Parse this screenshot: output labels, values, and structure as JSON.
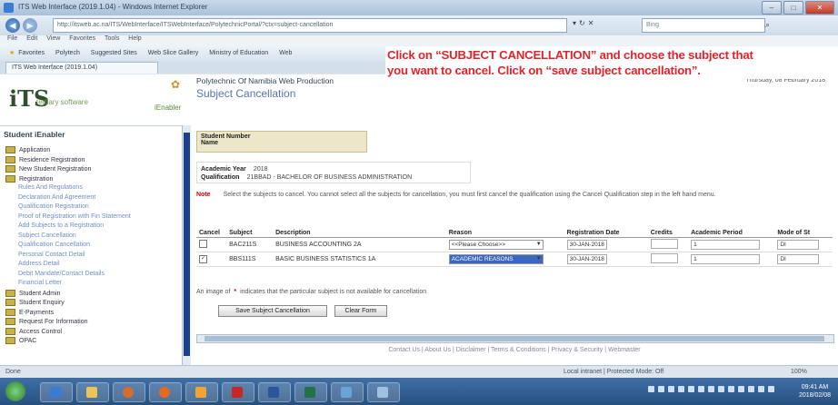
{
  "window": {
    "title": "ITS Web Interface (2019.1.04) - Windows Internet Explorer",
    "controls": [
      "–",
      "□",
      "✕"
    ]
  },
  "browser": {
    "address": "http://itsweb.ac.na/ITS/WebInterface/ITSWebInterface/PolytechnicPortal/?ctx=subject-cancellation",
    "addr_buttons": [
      "▾",
      "↻",
      "✕"
    ],
    "search_placeholder": "Bing",
    "menu": [
      "File",
      "Edit",
      "View",
      "Favorites",
      "Tools",
      "Help"
    ],
    "favorites": [
      "Favorites",
      "Polytech",
      "Suggested Sites",
      "Web Slice Gallery",
      "Ministry of Education",
      "Web"
    ],
    "tab": "ITS Web Interface (2019.1.04)"
  },
  "callout": {
    "line1": "Click on “SUBJECT CANCELLATION” and choose the subject that",
    "line2": "you want to cancel.  Click on “save subject cancellation”."
  },
  "header": {
    "logo_mark": "iTS",
    "logo_sub": "tertiary software",
    "portal": "iEnabler",
    "institution": "Polytechnic Of Namibia Web Production",
    "page_title": "Subject Cancellation",
    "date": "Thursday, 08 February 2018"
  },
  "sidebar": {
    "title": "Student iEnabler",
    "items": [
      {
        "label": "Application",
        "type": "folder"
      },
      {
        "label": "Residence Registration",
        "type": "folder"
      },
      {
        "label": "New Student Registration",
        "type": "folder"
      },
      {
        "label": "Registration",
        "type": "folder"
      },
      {
        "label": "Rules And Regulations",
        "type": "sub"
      },
      {
        "label": "Declaration And Agreement",
        "type": "sub"
      },
      {
        "label": "Qualification Registration",
        "type": "sub"
      },
      {
        "label": "Proof of Registration with Fin Statement",
        "type": "sub"
      },
      {
        "label": "Add Subjects to a Registration",
        "type": "sub"
      },
      {
        "label": "Subject Cancellation",
        "type": "sub"
      },
      {
        "label": "Qualification Cancellation",
        "type": "sub"
      },
      {
        "label": "Personal Contact Detail",
        "type": "sub"
      },
      {
        "label": "Address Detail",
        "type": "sub"
      },
      {
        "label": "Debit Mandate/Contact Details",
        "type": "sub"
      },
      {
        "label": "Financial Letter",
        "type": "sub"
      },
      {
        "label": "Student Admin",
        "type": "folder"
      },
      {
        "label": "Student Enquiry",
        "type": "folder"
      },
      {
        "label": "E-Payments",
        "type": "folder"
      },
      {
        "label": "Request For Information",
        "type": "folder"
      },
      {
        "label": "Access Control",
        "type": "folder"
      },
      {
        "label": "OPAC",
        "type": "folder"
      }
    ]
  },
  "student": {
    "number_label": "Student Number",
    "name_label": "Name"
  },
  "qualification": {
    "year_label": "Academic Year",
    "year": "2018",
    "qual_label": "Qualification",
    "qual": "21BBAD - BACHELOR OF BUSINESS ADMINISTRATION"
  },
  "note": {
    "label": "Note",
    "text": "Select the subjects to cancel. You cannot select all the subjects for cancellation, you must first cancel the qualification using the Cancel Qualification step in the left hand menu."
  },
  "table": {
    "headers": [
      "Cancel",
      "Subject",
      "Description",
      "Reason",
      "Registration Date",
      "Credits",
      "Academic Period",
      "Mode of St"
    ],
    "rows": [
      {
        "checked": false,
        "subject": "BAC211S",
        "description": "BUSINESS ACCOUNTING 2A",
        "reason": "<<Please Choose>>",
        "reason_highlight": false,
        "date": "30-JAN-2018",
        "credits": "",
        "period": "1",
        "mode": "DI"
      },
      {
        "checked": true,
        "subject": "BBS111S",
        "description": "BASIC BUSINESS STATISTICS 1A",
        "reason": "ACADEMIC REASONS",
        "reason_highlight": true,
        "date": "30-JAN-2018",
        "credits": "",
        "period": "1",
        "mode": "DI"
      }
    ]
  },
  "legend": {
    "prefix": "An image of",
    "star": "*",
    "text": "indicates that the particular subject is not available for cancellation"
  },
  "buttons": {
    "save": "Save Subject Cancellation",
    "clear": "Clear Form"
  },
  "footer": "Contact Us  |  About Us  |  Disclaimer  |  Terms & Conditions  |  Privacy & Security  |  Webmaster",
  "status": {
    "left": "Done",
    "zone": "Local intranet | Protected Mode: Off",
    "zoom": "100%"
  },
  "clock": {
    "time": "09:41 AM",
    "date": "2018/02/08"
  }
}
